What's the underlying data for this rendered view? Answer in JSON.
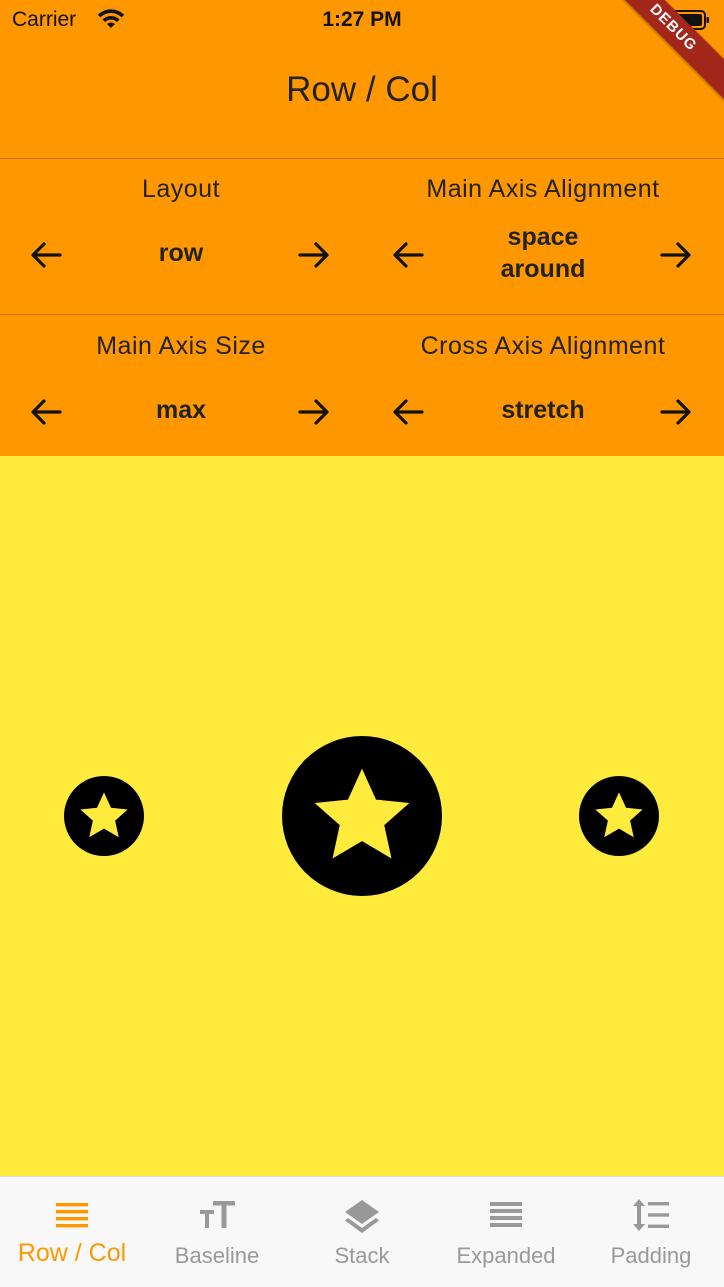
{
  "status_bar": {
    "carrier": "Carrier",
    "time": "1:27 PM"
  },
  "debug_banner": "DEBUG",
  "app_bar": {
    "title": "Row / Col"
  },
  "controls": {
    "layout": {
      "label": "Layout",
      "value": "row"
    },
    "main_axis_alignment": {
      "label": "Main Axis Alignment",
      "value_line1": "space",
      "value_line2": "around"
    },
    "main_axis_size": {
      "label": "Main Axis Size",
      "value": "max"
    },
    "cross_axis_alignment": {
      "label": "Cross Axis Alignment",
      "value": "stretch"
    }
  },
  "nav": {
    "items": [
      {
        "label": "Row / Col",
        "icon": "menu-icon"
      },
      {
        "label": "Baseline",
        "icon": "text-fields-icon"
      },
      {
        "label": "Stack",
        "icon": "layers-icon"
      },
      {
        "label": "Expanded",
        "icon": "view-headline-icon"
      },
      {
        "label": "Padding",
        "icon": "format-line-spacing-icon"
      }
    ]
  },
  "colors": {
    "primary": "#ff9800",
    "canvas": "#ffeb3b",
    "debug": "#a4271b"
  }
}
